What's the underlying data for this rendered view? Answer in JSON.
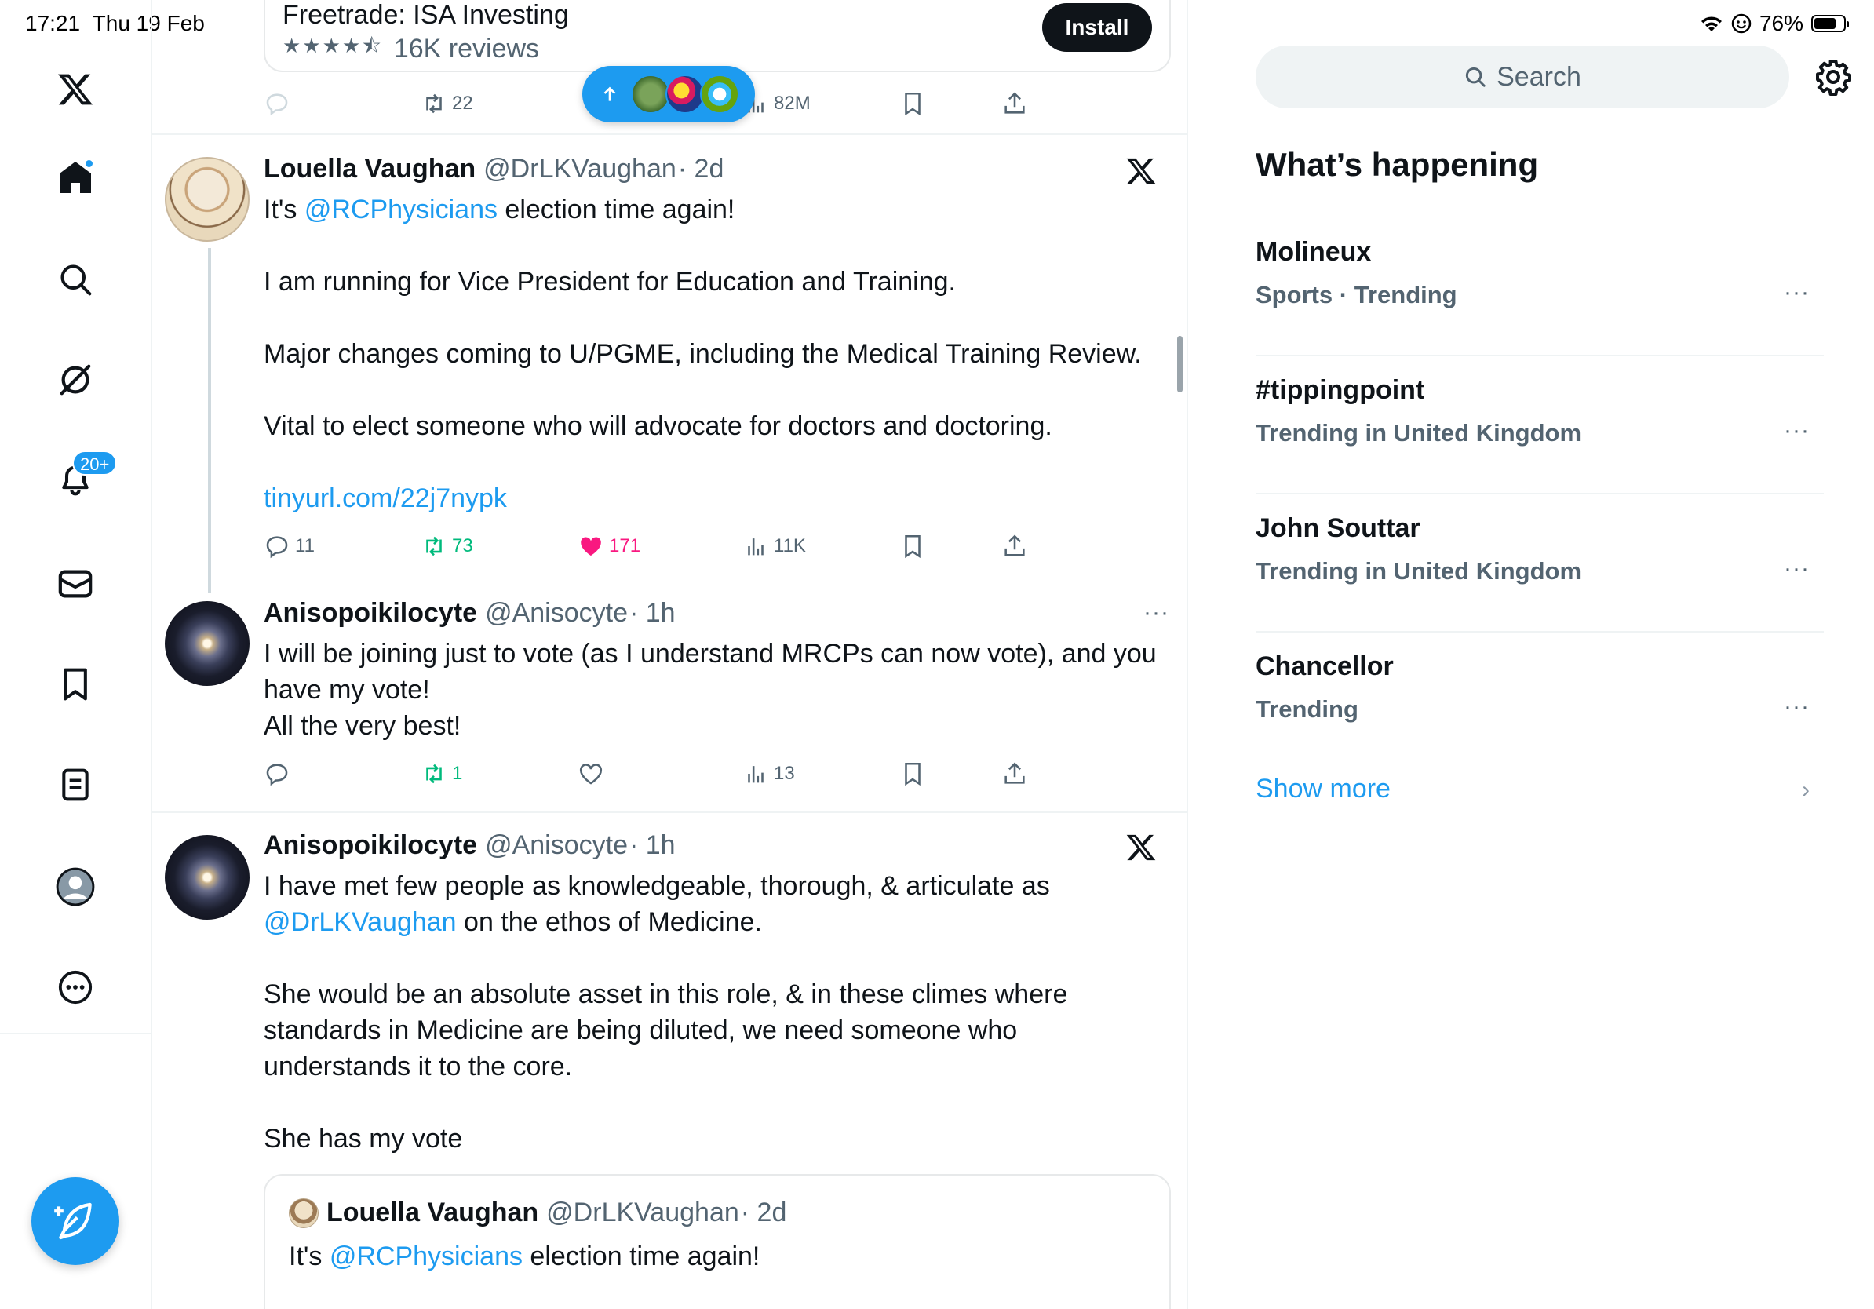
{
  "status_bar": {
    "time": "17:21",
    "date": "Thu 19 Feb",
    "battery": "76%",
    "battery_level": 0.76
  },
  "nav": {
    "notifications_badge": "20+",
    "accent_color": "#1d9bf0",
    "icons": [
      "x-logo-icon",
      "home-icon",
      "search-icon",
      "grok-icon",
      "bell-icon",
      "mail-icon",
      "bookmark-icon",
      "lists-icon",
      "profile-icon",
      "more-icon",
      "compose-icon"
    ]
  },
  "ad": {
    "title": "Freetrade: ISA Investing",
    "stars": "★★★★⯪",
    "reviews": "16K reviews",
    "install_label": "Install",
    "actions": {
      "reposts": "22",
      "views": "82M"
    }
  },
  "posts": [
    {
      "name": "Louella Vaughan",
      "handle": "@DrLKVaughan",
      "time": "· 2d",
      "text_1": "It's ",
      "mention_1": "@RCPhysicians",
      "text_2": " election time again!",
      "para_2": "I am running for Vice President for Education and Training.",
      "para_3": "Major changes coming to U/PGME, including the Medical Training Review.",
      "para_4": "Vital to elect someone who will advocate for doctors and doctoring.",
      "link": "tinyurl.com/22j7nypk",
      "actions": {
        "replies": "11",
        "reposts": "73",
        "likes": "171",
        "views": "11K"
      },
      "liked": true
    },
    {
      "name": "Anisopoikilocyte",
      "handle": "@Anisocyte",
      "time": "· 1h",
      "line_1": "I will be joining just to vote (as I understand MRCPs can now vote), and you",
      "line_2": "have my vote!",
      "line_3": "All the very best!",
      "more": "···",
      "actions": {
        "replies": "",
        "reposts": "1",
        "likes": "",
        "views": "13"
      }
    },
    {
      "name": "Anisopoikilocyte",
      "handle": "@Anisocyte",
      "time": "· 1h",
      "line_1": "I have met few people as knowledgeable, thorough, & articulate as",
      "mention": "@DrLKVaughan",
      "line_2_rest": " on the ethos of Medicine.",
      "para_2_l1": "She would be an absolute asset in this role, & in these climes where",
      "para_2_l2": "standards in Medicine are being diluted, we need someone who",
      "para_2_l3": "understands it to the core.",
      "para_3": "She has my vote",
      "quote": {
        "name": "Louella Vaughan",
        "handle": "@DrLKVaughan",
        "time": "· 2d",
        "text_1": "It's ",
        "mention": "@RCPhysicians",
        "text_2": " election time again!"
      }
    }
  ],
  "sidebar": {
    "search_placeholder": "Search",
    "title": "What’s happening",
    "trends": [
      {
        "name": "Molineux",
        "meta": "Sports · Trending"
      },
      {
        "name": "#tippingpoint",
        "meta": "Trending in United Kingdom"
      },
      {
        "name": "John Souttar",
        "meta": "Trending in United Kingdom"
      },
      {
        "name": "Chancellor",
        "meta": "Trending"
      }
    ],
    "more_label": "···",
    "show_more": "Show more",
    "chevron": "›"
  }
}
